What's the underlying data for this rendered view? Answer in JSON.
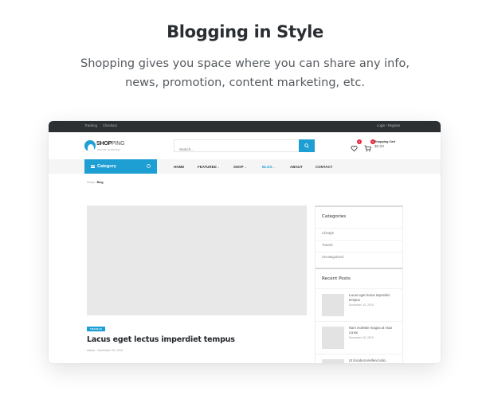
{
  "hero": {
    "title": "Blogging in Style",
    "subtitle_line1": "Shopping gives you space where you can share any info,",
    "subtitle_line2": "news, promotion, content marketing, etc."
  },
  "topbar": {
    "links": [
      "Tracking",
      "Checkout"
    ],
    "account": "Login / Register"
  },
  "header": {
    "logo_bold": "SHOP",
    "logo_light": "PING",
    "logo_tagline": "ONLINE SHOPPING",
    "search_placeholder": "Search...",
    "wishlist_count": "0",
    "cart_count": "0",
    "cart_label": "Shopping Cart",
    "cart_total": "$0.00"
  },
  "nav": {
    "category_label": "Category",
    "items": [
      {
        "label": "HOME",
        "dropdown": false,
        "active": false
      },
      {
        "label": "FEATURED",
        "dropdown": true,
        "active": false
      },
      {
        "label": "SHOP",
        "dropdown": true,
        "active": false
      },
      {
        "label": "BLOG",
        "dropdown": true,
        "active": true
      },
      {
        "label": "ABOUT",
        "dropdown": false,
        "active": false
      },
      {
        "label": "CONTACT",
        "dropdown": false,
        "active": false
      }
    ],
    "chevron": "⌄"
  },
  "breadcrumb": {
    "home": "Home",
    "separator": " / ",
    "current": "Blog"
  },
  "post": {
    "tag": "TRAVELS",
    "title": "Lacus eget lectus imperdiet tempus",
    "author": "Admin",
    "separator": " - ",
    "date": "November 15, 2019"
  },
  "sidebar": {
    "categories_title": "Categories",
    "categories": [
      "Lifestyle",
      "Travels",
      "Uncategorized"
    ],
    "recent_title": "Recent Posts",
    "recent_posts": [
      {
        "title": "Lacus eget lectus imperdiet tempus",
        "date": "November 15, 2019"
      },
      {
        "title": "Nam molestie magna at risus conse",
        "date": "November 15, 2019"
      },
      {
        "title": "Ut tincidunt eleifend odio,",
        "date": ""
      }
    ]
  },
  "colors": {
    "accent": "#1e9fd4",
    "topbar": "#2c3033",
    "badge": "#e9263d",
    "placeholder_image": "#e8e8e8"
  }
}
